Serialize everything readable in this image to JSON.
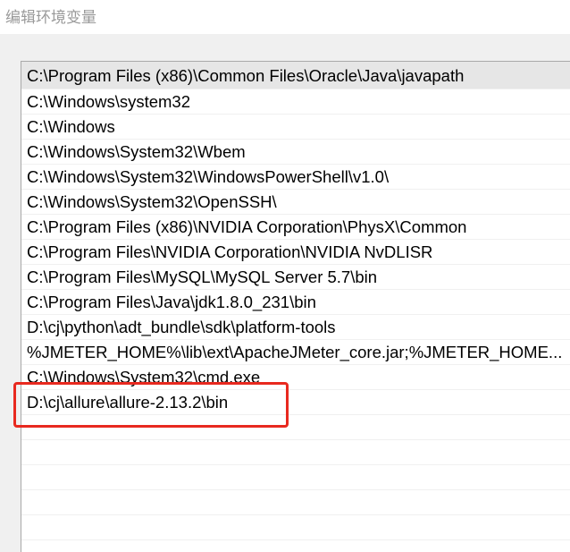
{
  "window": {
    "title": "编辑环境变量"
  },
  "path_list": {
    "items": [
      {
        "label": "C:\\Program Files (x86)\\Common Files\\Oracle\\Java\\javapath",
        "selected": true
      },
      {
        "label": "C:\\Windows\\system32"
      },
      {
        "label": "C:\\Windows"
      },
      {
        "label": "C:\\Windows\\System32\\Wbem"
      },
      {
        "label": "C:\\Windows\\System32\\WindowsPowerShell\\v1.0\\"
      },
      {
        "label": "C:\\Windows\\System32\\OpenSSH\\"
      },
      {
        "label": "C:\\Program Files (x86)\\NVIDIA Corporation\\PhysX\\Common"
      },
      {
        "label": "C:\\Program Files\\NVIDIA Corporation\\NVIDIA NvDLISR"
      },
      {
        "label": "C:\\Program Files\\MySQL\\MySQL Server 5.7\\bin"
      },
      {
        "label": "C:\\Program Files\\Java\\jdk1.8.0_231\\bin"
      },
      {
        "label": "D:\\cj\\python\\adt_bundle\\sdk\\platform-tools"
      },
      {
        "label": "%JMETER_HOME%\\lib\\ext\\ApacheJMeter_core.jar;%JMETER_HOME..."
      },
      {
        "label": "C:\\Windows\\System32\\cmd.exe"
      },
      {
        "label": "D:\\cj\\allure\\allure-2.13.2\\bin"
      },
      {
        "label": ""
      },
      {
        "label": ""
      },
      {
        "label": ""
      },
      {
        "label": ""
      },
      {
        "label": ""
      },
      {
        "label": ""
      }
    ]
  },
  "annotation": {
    "color": "#e8291f"
  }
}
